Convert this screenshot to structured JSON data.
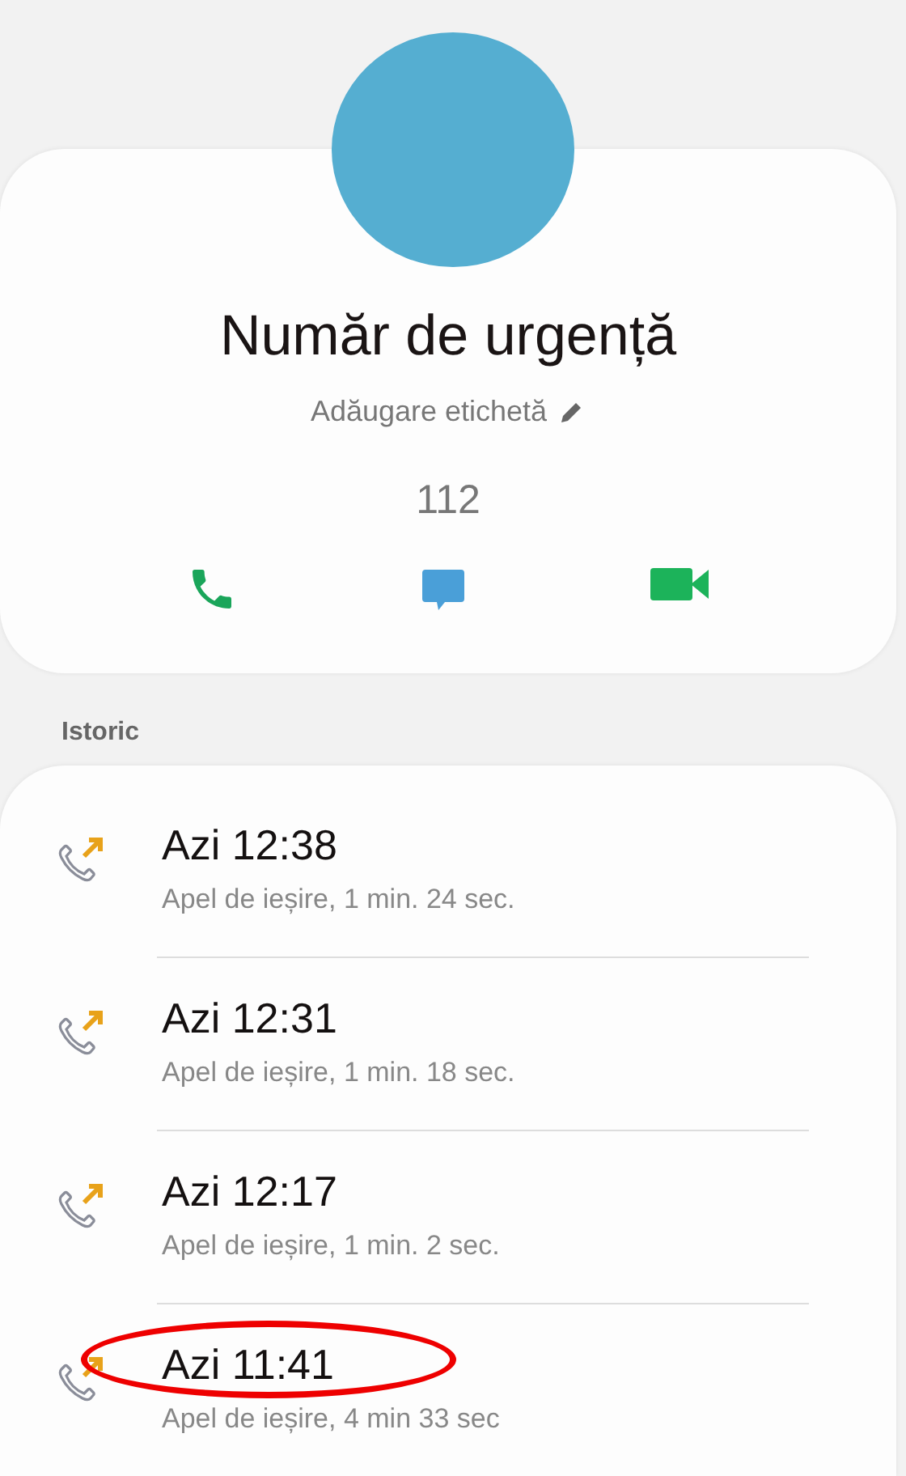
{
  "contact": {
    "name": "Număr de urgență",
    "label_action": "Adăugare etichetă",
    "number": "112"
  },
  "history": {
    "title": "Istoric",
    "entries": [
      {
        "time": "Azi 12:38",
        "detail": "Apel de ieșire, 1 min. 24 sec.",
        "highlighted": false
      },
      {
        "time": "Azi 12:31",
        "detail": "Apel de ieșire, 1 min. 18 sec.",
        "highlighted": false
      },
      {
        "time": "Azi 12:17",
        "detail": "Apel de ieșire, 1 min. 2 sec.",
        "highlighted": false
      },
      {
        "time": "Azi 11:41",
        "detail": "Apel de ieșire, 4 min 33 sec",
        "highlighted": true
      }
    ]
  }
}
